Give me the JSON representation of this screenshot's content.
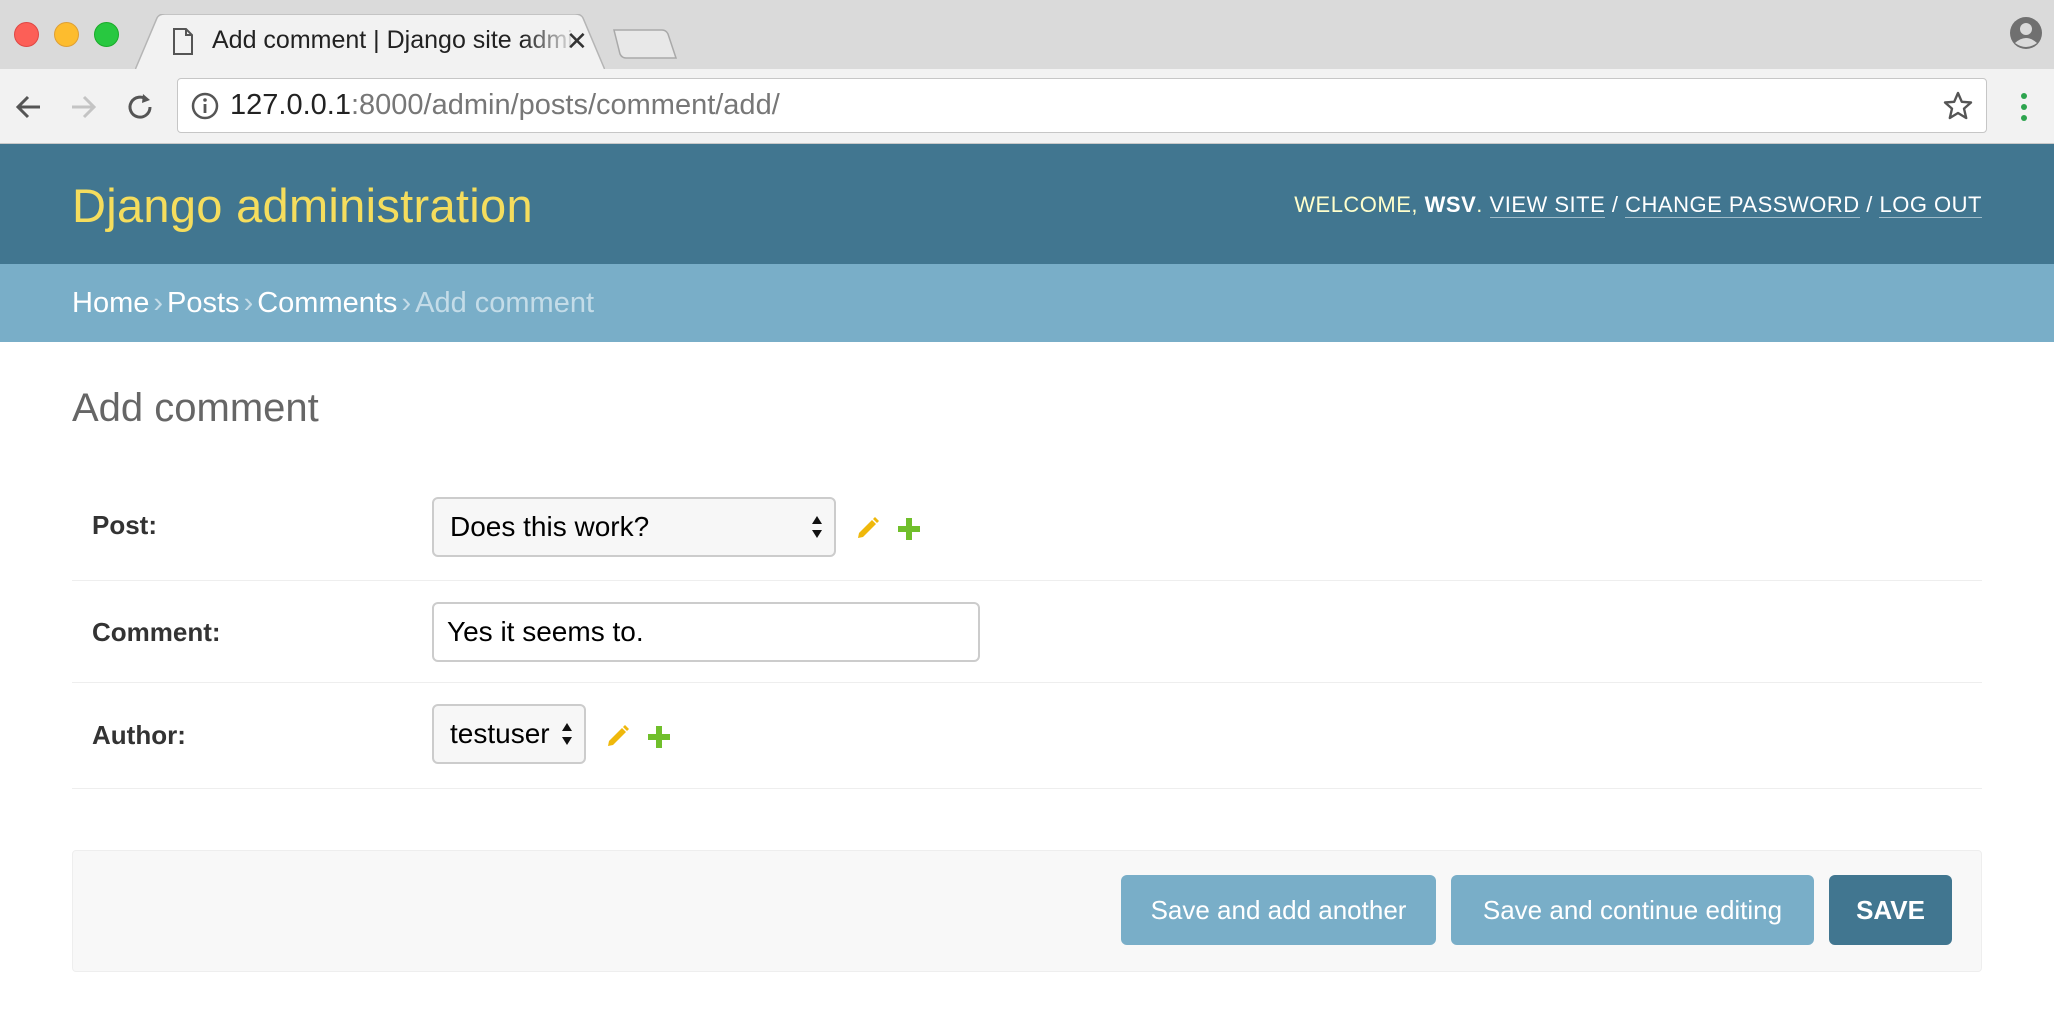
{
  "browser": {
    "tab_title": "Add comment | Django site admin",
    "url_host": "127.0.0.1",
    "url_rest": ":8000/admin/posts/comment/add/"
  },
  "header": {
    "branding": "Django administration",
    "welcome": "Welcome,",
    "username": "wsv",
    "view_site": "View site",
    "change_password": "Change password",
    "log_out": "Log out",
    "sep": "/"
  },
  "breadcrumbs": {
    "home": "Home",
    "posts": "Posts",
    "comments": "Comments",
    "current": "Add comment",
    "sep": "›"
  },
  "page": {
    "title": "Add comment"
  },
  "form": {
    "post": {
      "label": "Post:",
      "value": "Does this work?"
    },
    "comment": {
      "label": "Comment:",
      "value": "Yes it seems to."
    },
    "author": {
      "label": "Author:",
      "value": "testuser"
    }
  },
  "buttons": {
    "save_add_another": "Save and add another",
    "save_continue": "Save and continue editing",
    "save": "Save"
  },
  "colors": {
    "header_bg": "#417690",
    "breadcrumb_bg": "#79aec8",
    "branding": "#f5dd5d",
    "edit_icon": "#efb80b",
    "add_icon": "#70bf2b"
  }
}
